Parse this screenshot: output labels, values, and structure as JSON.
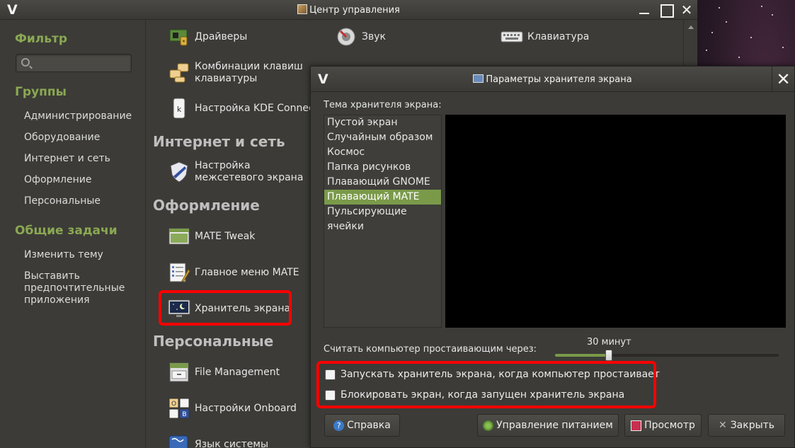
{
  "window": {
    "title": "Центр управления"
  },
  "sidebar": {
    "filter_heading": "Фильтр",
    "search_placeholder": "",
    "groups_heading": "Группы",
    "groups": [
      {
        "label": "Администрирование"
      },
      {
        "label": "Оборудование"
      },
      {
        "label": "Интернет и сеть"
      },
      {
        "label": "Оформление"
      },
      {
        "label": "Персональные"
      }
    ],
    "tasks_heading": "Общие задачи",
    "tasks": [
      {
        "label": "Изменить тему"
      },
      {
        "label": "Выставить предпочтительные приложения"
      }
    ]
  },
  "content": {
    "hardware_items": [
      {
        "label": "Драйверы",
        "icon": "driver-chip-icon"
      },
      {
        "label": "Звук",
        "icon": "sound-icon"
      },
      {
        "label": "Клавиатура",
        "icon": "keyboard-icon"
      },
      {
        "label": "Комбинации клавиш клавиатуры",
        "icon": "keyboard-shortcuts-icon"
      },
      {
        "label": "Настройка KDE Connect",
        "icon": "kde-connect-icon"
      }
    ],
    "internet_heading": "Интернет и сеть",
    "internet_items": [
      {
        "label": "Настройка межсетевого экрана",
        "icon": "firewall-shield-icon"
      }
    ],
    "appearance_heading": "Оформление",
    "appearance_items": [
      {
        "label": "MATE Tweak",
        "icon": "mate-tweak-icon"
      },
      {
        "label": "Главное меню MATE",
        "icon": "main-menu-icon"
      },
      {
        "label": "Хранитель экрана",
        "icon": "screensaver-icon"
      }
    ],
    "personal_heading": "Персональные",
    "personal_items": [
      {
        "label": "File Management",
        "icon": "file-cabinet-icon"
      },
      {
        "label": "Настройки Onboard",
        "icon": "onboard-keys-icon"
      },
      {
        "label": "Язык системы",
        "icon": "language-icon"
      }
    ]
  },
  "dialog": {
    "title": "Параметры хранителя экрана",
    "theme_label": "Тема хранителя экрана:",
    "themes": [
      {
        "label": "Пустой экран"
      },
      {
        "label": "Случайным образом"
      },
      {
        "label": "Космос"
      },
      {
        "label": "Папка рисунков"
      },
      {
        "label": "Плавающий GNOME"
      },
      {
        "label": "Плавающий MATE"
      },
      {
        "label": "Пульсирующие ячейки"
      }
    ],
    "selected_theme": "Плавающий MATE",
    "idle_label": "Считать компьютер простаивающим через:",
    "idle_value": "30 минут",
    "idle_fraction": 0.24,
    "activate_label": "Запускать хранитель экрана, когда компьютер простаивает",
    "activate_checked": false,
    "lock_label": "Блокировать экран, когда запущен хранитель экрана",
    "lock_checked": false,
    "buttons": {
      "help": "Справка",
      "power": "Управление питанием",
      "preview": "Просмотр",
      "close": "Закрыть"
    }
  },
  "colors": {
    "accent": "#7a9a4a",
    "highlight": "#ff0000"
  }
}
